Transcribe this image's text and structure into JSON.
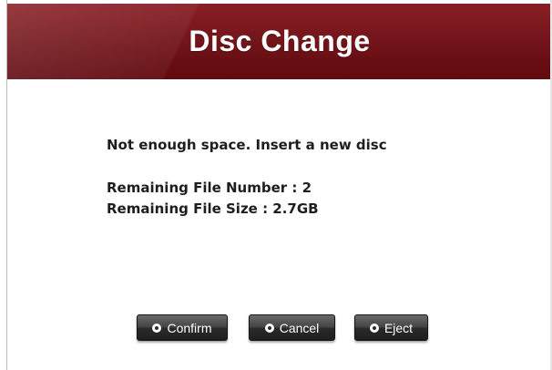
{
  "dialog": {
    "title": "Disc Change",
    "message": "Not enough space. Insert a new disc",
    "remaining_file_number": "Remaining File Number : 2",
    "remaining_file_size": "Remaining File Size : 2.7GB"
  },
  "buttons": {
    "confirm_label": "Confirm",
    "cancel_label": "Cancel",
    "eject_label": "Eject"
  },
  "colors": {
    "title_bar": "#74161b",
    "button": "#333333",
    "text": "#1e1e1e"
  },
  "icons": {
    "button_bullet": "radio-bullet-icon"
  }
}
